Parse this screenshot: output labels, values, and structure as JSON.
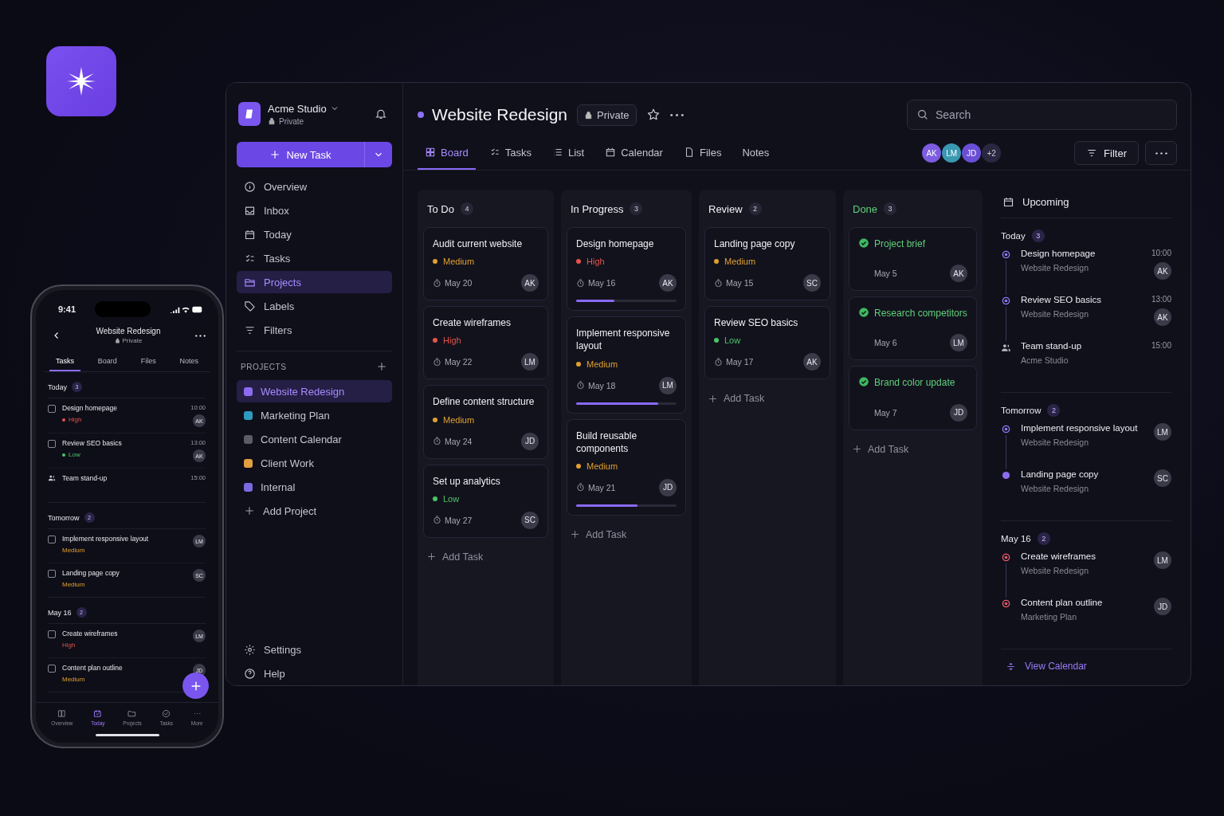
{
  "workspace": {
    "name": "Acme Studio",
    "privacy": "Private"
  },
  "new_task": "New Task",
  "nav": [
    {
      "label": "Overview",
      "selected": false
    },
    {
      "label": "Inbox",
      "selected": false
    },
    {
      "label": "Today",
      "selected": false
    },
    {
      "label": "Tasks",
      "selected": false
    },
    {
      "label": "Projects",
      "selected": true
    },
    {
      "label": "Labels",
      "selected": false
    },
    {
      "label": "Filters",
      "selected": false
    }
  ],
  "projects_heading": "PROJECTS",
  "projects": [
    {
      "name": "Website Redesign",
      "color": "#8b6cf0",
      "selected": true
    },
    {
      "name": "Marketing Plan",
      "color": "#2e9cc0",
      "selected": false
    },
    {
      "name": "Content Calendar",
      "color": "#5c5c68",
      "selected": false
    },
    {
      "name": "Client Work",
      "color": "#e0a040",
      "selected": false
    },
    {
      "name": "Internal",
      "color": "#7a6ae0",
      "selected": false
    }
  ],
  "add_project": "Add Project",
  "footer_nav": [
    "Settings",
    "Help"
  ],
  "project": {
    "title": "Website Redesign",
    "privacy": "Private"
  },
  "tabs": [
    {
      "label": "Board",
      "selected": true
    },
    {
      "label": "Tasks",
      "selected": false
    },
    {
      "label": "List",
      "selected": false
    },
    {
      "label": "Calendar",
      "selected": false
    },
    {
      "label": "Files",
      "selected": false
    },
    {
      "label": "Notes",
      "selected": false
    }
  ],
  "search": {
    "placeholder": "Search"
  },
  "members": [
    {
      "initials": "AK",
      "color": "#7c5ce0"
    },
    {
      "initials": "LM",
      "color": "#3a98b0"
    },
    {
      "initials": "JD",
      "color": "#6a4fd6"
    }
  ],
  "more_members": "+2",
  "filter": "Filter",
  "columns": [
    {
      "title": "To Do",
      "count": "4",
      "kind": "open",
      "add_task": "Add Task",
      "cards": [
        {
          "title": "Audit current website",
          "priority": {
            "label": "Medium",
            "kind": "medium"
          },
          "date": "May 20",
          "assignee": "AK",
          "done": false
        },
        {
          "title": "Create wireframes",
          "priority": {
            "label": "High",
            "kind": "high"
          },
          "date": "May 22",
          "assignee": "LM",
          "done": false
        },
        {
          "title": "Define content structure",
          "priority": {
            "label": "Medium",
            "kind": "medium"
          },
          "date": "May 24",
          "assignee": "JD",
          "done": false
        },
        {
          "title": "Set up analytics",
          "priority": {
            "label": "Low",
            "kind": "low"
          },
          "date": "May 27",
          "assignee": "SC",
          "done": false
        }
      ]
    },
    {
      "title": "In Progress",
      "count": "3",
      "kind": "open",
      "add_task": "Add Task",
      "cards": [
        {
          "title": "Design homepage",
          "priority": {
            "label": "High",
            "kind": "high"
          },
          "date": "May 16",
          "assignee": "AK",
          "done": false,
          "level": 0.38
        },
        {
          "title": "Implement responsive layout",
          "priority": {
            "label": "Medium",
            "kind": "medium"
          },
          "date": "May 18",
          "assignee": "LM",
          "done": false,
          "level": 0.82
        },
        {
          "title": "Build reusable components",
          "priority": {
            "label": "Medium",
            "kind": "medium"
          },
          "date": "May 21",
          "assignee": "JD",
          "done": false,
          "level": 0.61
        }
      ]
    },
    {
      "title": "Review",
      "count": "2",
      "kind": "open",
      "add_task": "Add Task",
      "cards": [
        {
          "title": "Landing page copy",
          "priority": {
            "label": "Medium",
            "kind": "medium"
          },
          "date": "May 15",
          "assignee": "SC",
          "done": false
        },
        {
          "title": "Review SEO basics",
          "priority": {
            "label": "Low",
            "kind": "low"
          },
          "date": "May 17",
          "assignee": "AK",
          "done": false
        }
      ]
    },
    {
      "title": "Done",
      "count": "3",
      "kind": "done",
      "add_task": "Add Task",
      "cards": [
        {
          "title": "Project brief",
          "date": "May 5",
          "assignee": "AK",
          "done": true
        },
        {
          "title": "Research competitors",
          "date": "May 6",
          "assignee": "LM",
          "done": true
        },
        {
          "title": "Brand color update",
          "date": "May 7",
          "assignee": "JD",
          "done": true
        }
      ]
    }
  ],
  "upcoming": {
    "title": "Upcoming",
    "view_calendar": "View Calendar",
    "groups": [
      {
        "label": "Today",
        "count": "3",
        "items": [
          {
            "kind": "ring",
            "color": "#8b7cf6",
            "title": "Design homepage",
            "project": "Website Redesign",
            "time": "10:00",
            "assignee": "AK"
          },
          {
            "kind": "ring",
            "color": "#8b7cf6",
            "title": "Review SEO basics",
            "project": "Website Redesign",
            "time": "13:00",
            "assignee": "AK"
          },
          {
            "kind": "event",
            "title": "Team stand-up",
            "project": "Acme Studio",
            "time": "15:00"
          }
        ]
      },
      {
        "label": "Tomorrow",
        "count": "2",
        "items": [
          {
            "kind": "ring",
            "color": "#8b7cf6",
            "title": "Implement responsive layout",
            "project": "Website Redesign",
            "assignee": "LM"
          },
          {
            "kind": "dot",
            "color": "#8b6cf0",
            "title": "Landing page copy",
            "project": "Website Redesign",
            "assignee": "SC"
          }
        ]
      },
      {
        "label": "May 16",
        "count": "2",
        "items": [
          {
            "kind": "ring",
            "color": "#e25c6a",
            "title": "Create wireframes",
            "project": "Website Redesign",
            "assignee": "LM"
          },
          {
            "kind": "ring",
            "color": "#e25c6a",
            "title": "Content plan outline",
            "project": "Marketing Plan",
            "assignee": "JD"
          }
        ]
      }
    ]
  },
  "phone": {
    "time": "9:41",
    "title": "Website Redesign",
    "privacy": "Private",
    "tabs": [
      {
        "label": "Tasks",
        "selected": true
      },
      {
        "label": "Board",
        "selected": false
      },
      {
        "label": "Files",
        "selected": false
      },
      {
        "label": "Notes",
        "selected": false
      }
    ],
    "groups": [
      {
        "label": "Today",
        "count": "3",
        "items": [
          {
            "kind": "task",
            "checked": false,
            "title": "Design homepage",
            "priority": {
              "label": "High",
              "kind": "high",
              "dot": true
            },
            "time": "10:00",
            "assignee": "AK"
          },
          {
            "kind": "task",
            "checked": false,
            "title": "Review SEO basics",
            "priority": {
              "label": "Low",
              "kind": "low",
              "dot": true
            },
            "time": "13:00",
            "assignee": "AK"
          },
          {
            "kind": "event",
            "title": "Team stand-up",
            "time": "15:00"
          }
        ]
      },
      {
        "label": "Tomorrow",
        "count": "2",
        "items": [
          {
            "kind": "task",
            "checked": false,
            "title": "Implement responsive layout",
            "priority": {
              "label": "Medium",
              "kind": "medium",
              "dot": false
            },
            "assignee": "LM"
          },
          {
            "kind": "task",
            "checked": false,
            "title": "Landing page copy",
            "priority": {
              "label": "Medium",
              "kind": "medium",
              "dot": false
            },
            "assignee": "SC"
          }
        ]
      },
      {
        "label": "May 16",
        "count": "2",
        "items": [
          {
            "kind": "task",
            "checked": false,
            "title": "Create wireframes",
            "priority": {
              "label": "High",
              "kind": "high",
              "dot": false
            },
            "assignee": "LM"
          },
          {
            "kind": "task",
            "checked": false,
            "title": "Content plan outline",
            "priority": {
              "label": "Medium",
              "kind": "medium",
              "dot": false
            },
            "assignee": "JD"
          }
        ]
      }
    ],
    "bottom_nav": [
      {
        "label": "Overview",
        "selected": false
      },
      {
        "label": "Today",
        "selected": true
      },
      {
        "label": "Projects",
        "selected": false
      },
      {
        "label": "Tasks",
        "selected": false
      },
      {
        "label": "More",
        "selected": false
      }
    ]
  }
}
